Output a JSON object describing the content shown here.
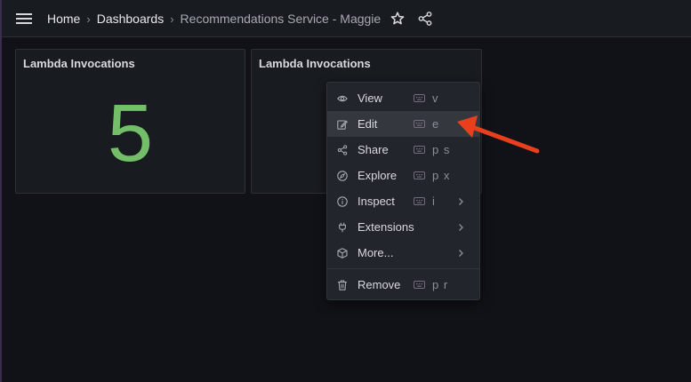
{
  "breadcrumb": {
    "home": "Home",
    "dashboards": "Dashboards",
    "current": "Recommendations Service - Maggie"
  },
  "topbar": {
    "menu_icon": "hamburger-menu-icon",
    "star_icon": "star-icon",
    "share_icon": "share-icon"
  },
  "panels": [
    {
      "title": "Lambda Invocations",
      "value": "5",
      "value_color": "#73bf69"
    },
    {
      "title": "Lambda Invocations"
    }
  ],
  "context_menu": {
    "items": [
      {
        "label": "View",
        "shortcut": "v",
        "icon": "eye-icon"
      },
      {
        "label": "Edit",
        "shortcut": "e",
        "icon": "edit-icon",
        "highlighted": true
      },
      {
        "label": "Share",
        "shortcut": "p s",
        "icon": "share-icon"
      },
      {
        "label": "Explore",
        "shortcut": "p x",
        "icon": "compass-icon"
      },
      {
        "label": "Inspect",
        "shortcut": "i",
        "icon": "info-circle-icon",
        "submenu": true
      },
      {
        "label": "Extensions",
        "shortcut": "",
        "icon": "plug-icon",
        "submenu": true
      },
      {
        "label": "More...",
        "shortcut": "",
        "icon": "cube-icon",
        "submenu": true
      },
      {
        "label": "Remove",
        "shortcut": "p r",
        "icon": "trash-icon"
      }
    ]
  },
  "colors": {
    "background": "#111217",
    "panel": "#181b1f",
    "stat_green": "#73bf69",
    "annotation_arrow": "#e8401c"
  }
}
